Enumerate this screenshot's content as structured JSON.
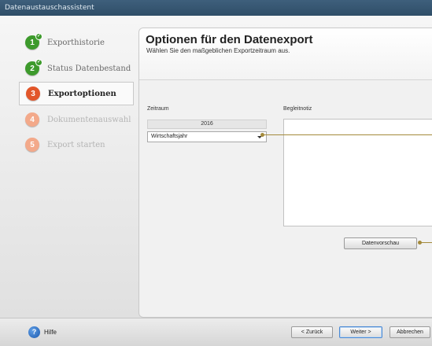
{
  "window": {
    "title": "Datenaustauschassistent"
  },
  "steps": [
    {
      "num": "1",
      "label": "Exporthistorie",
      "state": "done"
    },
    {
      "num": "2",
      "label": "Status Datenbestand",
      "state": "done"
    },
    {
      "num": "3",
      "label": "Exportoptionen",
      "state": "current"
    },
    {
      "num": "4",
      "label": "Dokumentenauswahl",
      "state": "todo"
    },
    {
      "num": "5",
      "label": "Export starten",
      "state": "todo"
    }
  ],
  "panel": {
    "title": "Optionen für den Datenexport",
    "subtitle": "Wählen Sie den maßgeblichen Exportzeitraum aus.",
    "zeitraum_label": "Zeitraum",
    "year": "2016",
    "period_select": "Wirtschaftsjahr",
    "note_label": "Begleitnotiz",
    "note_value": "",
    "preview_button": "Datenvorschau"
  },
  "footer": {
    "help": "Hilfe",
    "back": "< Zurück",
    "next": "Weiter >",
    "cancel": "Abbrechen"
  },
  "colors": {
    "step_done": "#3d9a2c",
    "step_current": "#e2562a",
    "step_todo": "#f3a98a",
    "callout": "#a48a3b",
    "titlebar": "#2f4e68"
  },
  "icons": {
    "help": "help-icon",
    "check": "checkmark-icon",
    "dropdown": "chevron-down-icon"
  }
}
